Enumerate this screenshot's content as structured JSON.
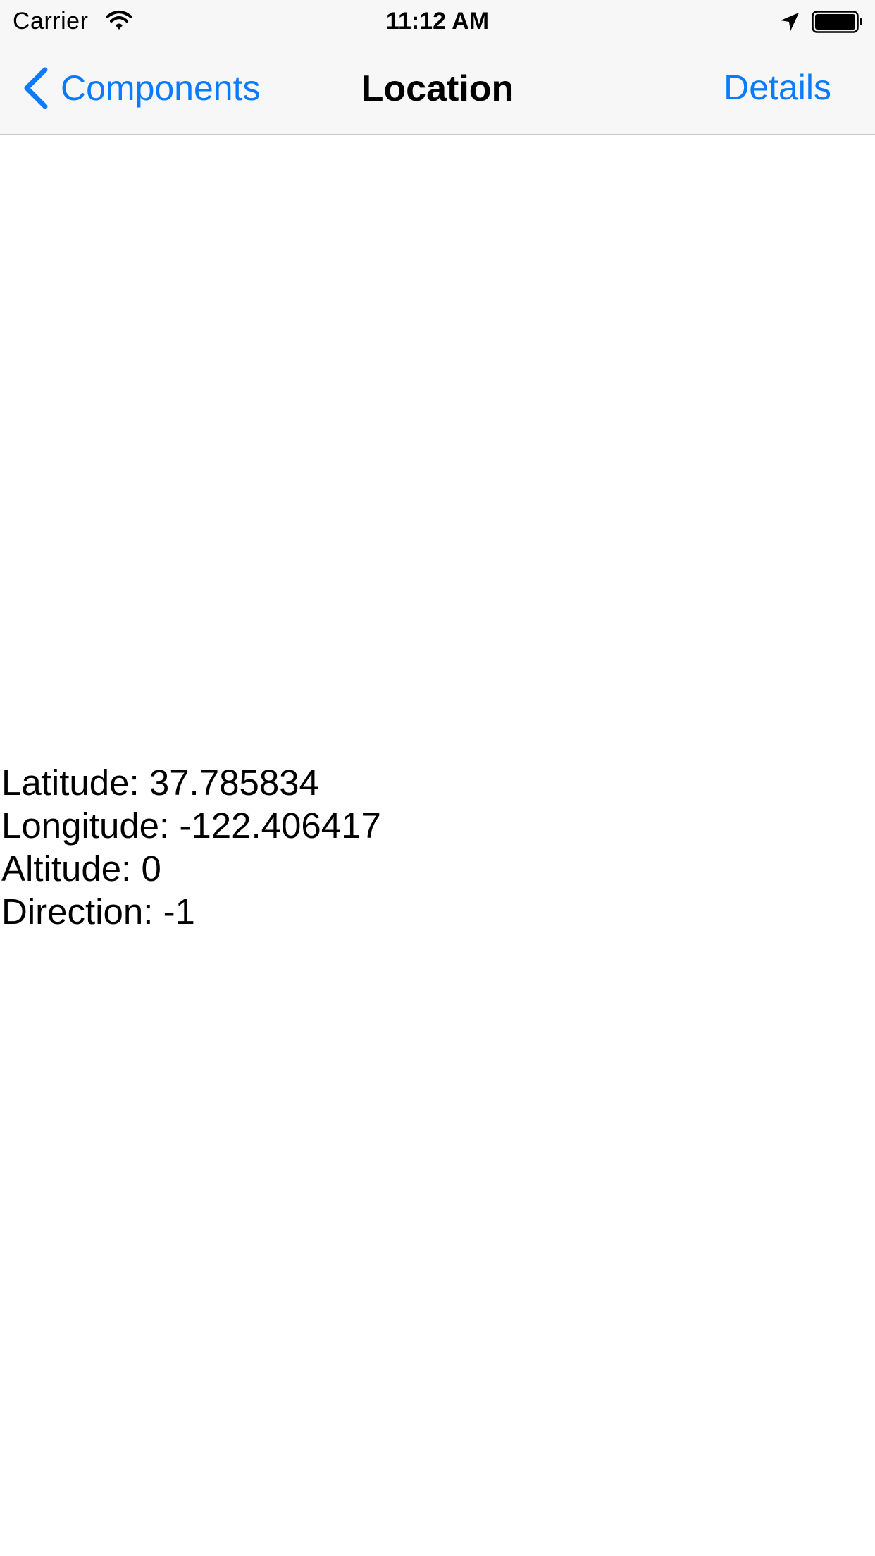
{
  "status_bar": {
    "carrier": "Carrier",
    "time": "11:12 AM",
    "icons": [
      "wifi-icon",
      "location-arrow-icon",
      "battery-icon"
    ]
  },
  "nav_bar": {
    "back_label": "Components",
    "title": "Location",
    "right_button_label": "Details",
    "back_icon": "chevron-left-icon"
  },
  "location": {
    "latitude": "Latitude: 37.785834",
    "longitude": "Longitude: -122.406417",
    "altitude": "Altitude: 0",
    "direction": "Direction: -1"
  },
  "colors": {
    "accent": "#0a7aff",
    "bar_background": "#f7f7f7",
    "text": "#000000",
    "page_background": "#ffffff"
  }
}
